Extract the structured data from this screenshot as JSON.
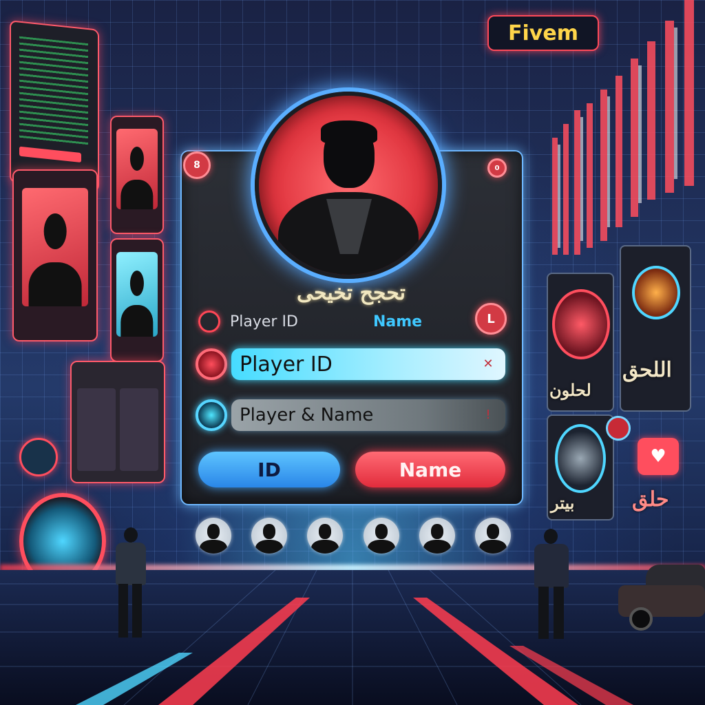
{
  "brand": {
    "label": "Fivem"
  },
  "panel": {
    "title": "تحجح تخيحى",
    "labels": {
      "player_id": "Player ID",
      "name": "Name"
    },
    "fields": {
      "player_id_value": "Player ID",
      "player_name_value": "Player & Name"
    },
    "buttons": {
      "id_label": "ID",
      "name_label": "Name"
    }
  },
  "right_side": {
    "text_top": "اللحق",
    "text_left": "لحلون",
    "text_bottom_left": "بيتر",
    "text_bottom_right": "حلق"
  },
  "colors": {
    "accent_red": "#e22c3c",
    "accent_cyan": "#46dcff",
    "brand_yellow": "#ffd54a"
  },
  "icons": [
    "player-avatar-icon",
    "player-id-icon",
    "player-name-icon",
    "heart-icon",
    "user-icon"
  ]
}
